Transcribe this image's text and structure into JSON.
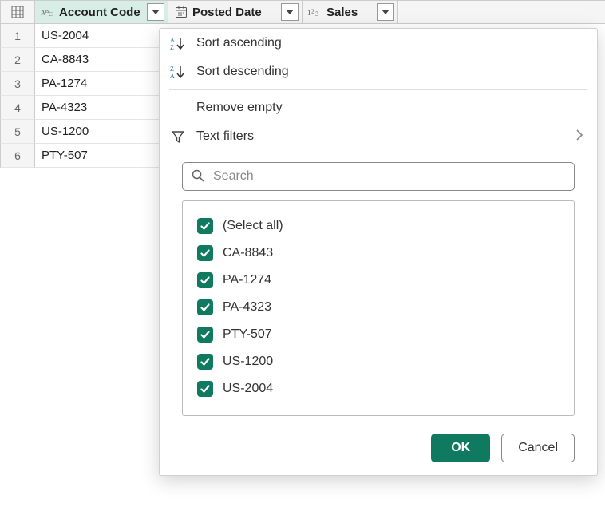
{
  "columns": [
    {
      "name": "Account Code",
      "type": "text"
    },
    {
      "name": "Posted Date",
      "type": "date"
    },
    {
      "name": "Sales",
      "type": "number"
    }
  ],
  "rows": [
    {
      "n": "1",
      "code": "US-2004"
    },
    {
      "n": "2",
      "code": "CA-8843"
    },
    {
      "n": "3",
      "code": "PA-1274"
    },
    {
      "n": "4",
      "code": "PA-4323"
    },
    {
      "n": "5",
      "code": "US-1200"
    },
    {
      "n": "6",
      "code": "PTY-507"
    }
  ],
  "menu": {
    "sort_asc": "Sort ascending",
    "sort_desc": "Sort descending",
    "remove_empty": "Remove empty",
    "text_filters": "Text filters"
  },
  "search": {
    "placeholder": "Search"
  },
  "filter_values": [
    {
      "label": "(Select all)",
      "checked": true
    },
    {
      "label": "CA-8843",
      "checked": true
    },
    {
      "label": "PA-1274",
      "checked": true
    },
    {
      "label": "PA-4323",
      "checked": true
    },
    {
      "label": "PTY-507",
      "checked": true
    },
    {
      "label": "US-1200",
      "checked": true
    },
    {
      "label": "US-2004",
      "checked": true
    }
  ],
  "buttons": {
    "ok": "OK",
    "cancel": "Cancel"
  }
}
